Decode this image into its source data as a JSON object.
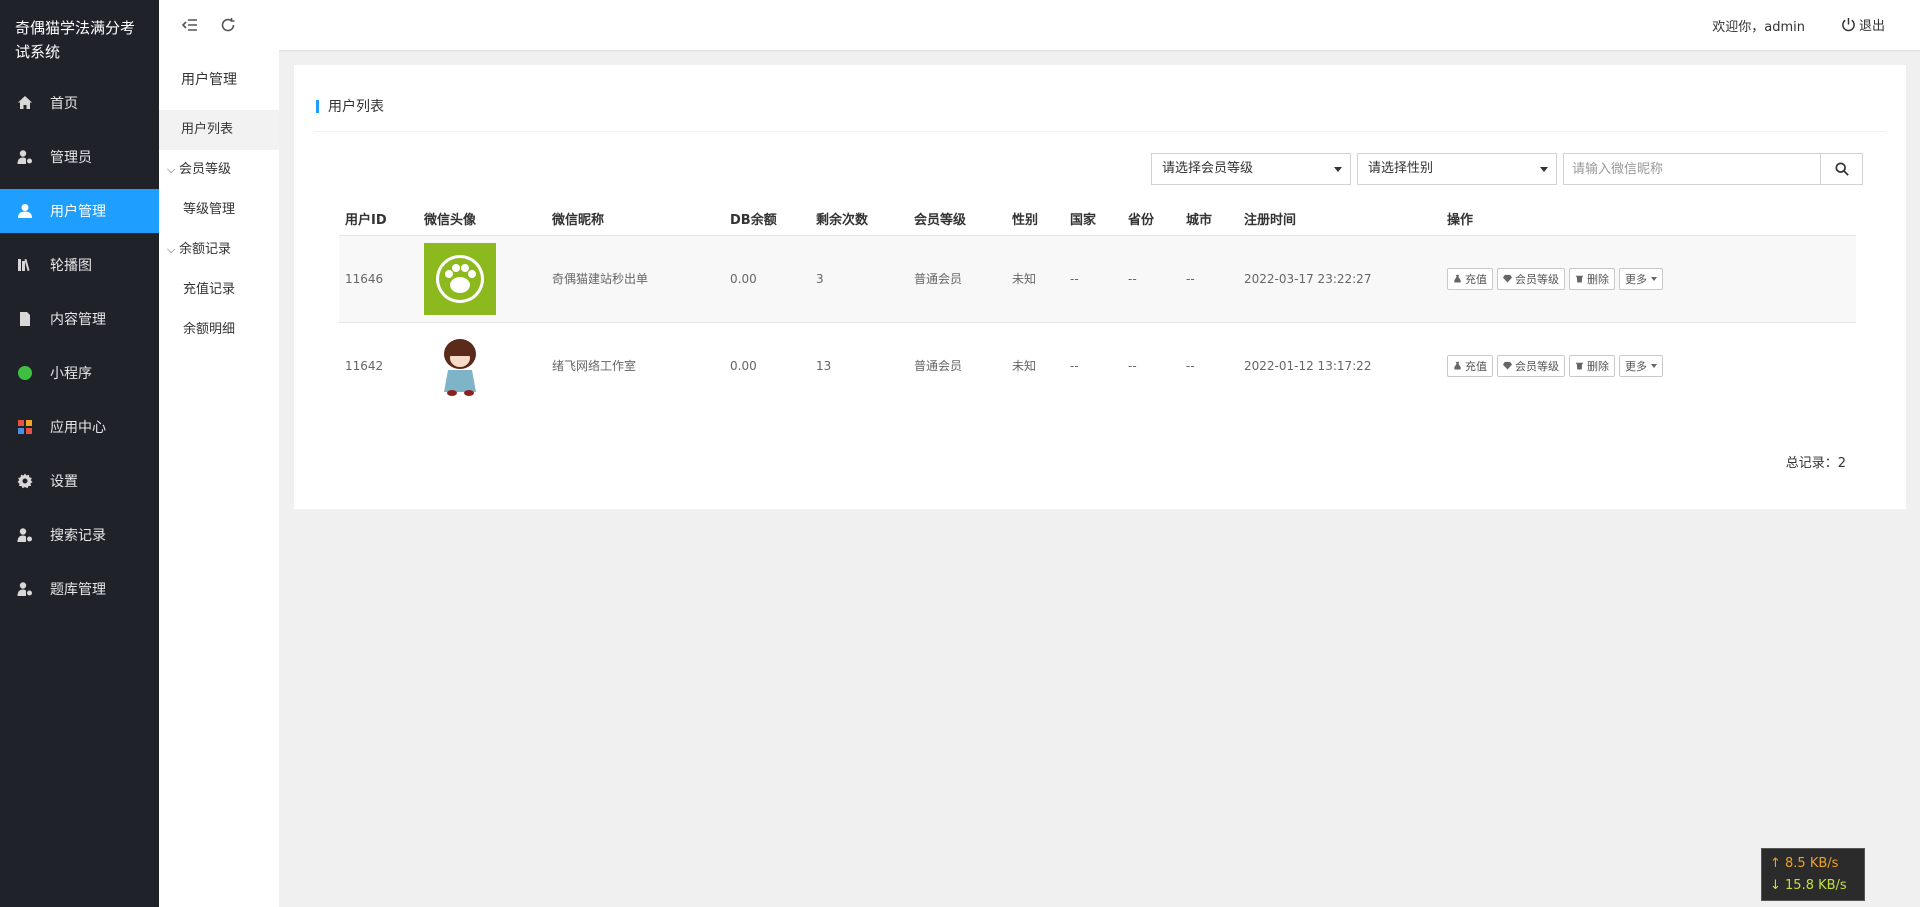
{
  "app": {
    "title": "奇偶猫学法满分考试系统"
  },
  "menu": {
    "items": [
      {
        "label": "首页",
        "icon": "home-icon"
      },
      {
        "label": "管理员",
        "icon": "user-gear-icon"
      },
      {
        "label": "用户管理",
        "icon": "user-icon",
        "active": true
      },
      {
        "label": "轮播图",
        "icon": "books-icon"
      },
      {
        "label": "内容管理",
        "icon": "document-icon"
      },
      {
        "label": "小程序",
        "icon": "miniprogram-icon"
      },
      {
        "label": "应用中心",
        "icon": "apps-icon"
      },
      {
        "label": "设置",
        "icon": "gear-icon"
      },
      {
        "label": "搜索记录",
        "icon": "user-gear-icon"
      },
      {
        "label": "题库管理",
        "icon": "user-gear-icon"
      }
    ]
  },
  "subnav": {
    "title": "用户管理",
    "items": {
      "user_list": "用户列表",
      "member_level": "会员等级",
      "level_manage": "等级管理",
      "balance_records": "余额记录",
      "recharge_records": "充值记录",
      "balance_detail": "余额明细"
    }
  },
  "header": {
    "welcome": "欢迎你，admin",
    "logout": "退出"
  },
  "card": {
    "title": "用户列表",
    "filters": {
      "level_select": "请选择会员等级",
      "gender_select": "请选择性别",
      "nickname_placeholder": "请输入微信昵称"
    },
    "columns": [
      "用户ID",
      "微信头像",
      "微信昵称",
      "DB余额",
      "剩余次数",
      "会员等级",
      "性别",
      "国家",
      "省份",
      "城市",
      "注册时间",
      "操作"
    ],
    "rows": [
      {
        "id": "11646",
        "nickname": "奇偶猫建站秒出单",
        "balance": "0.00",
        "remaining": "3",
        "level": "普通会员",
        "gender": "未知",
        "country": "--",
        "province": "--",
        "city": "--",
        "registered": "2022-03-17 23:22:27"
      },
      {
        "id": "11642",
        "nickname": "绪飞网络工作室",
        "balance": "0.00",
        "remaining": "13",
        "level": "普通会员",
        "gender": "未知",
        "country": "--",
        "province": "--",
        "city": "--",
        "registered": "2022-01-12 13:17:22"
      }
    ],
    "actions": {
      "recharge": "充值",
      "member_level": "会员等级",
      "delete": "删除",
      "more": "更多"
    },
    "total": "总记录：2"
  },
  "netspeed": {
    "up": "↑ 8.5 KB/s",
    "down": "↓ 15.8 KB/s"
  },
  "colors": {
    "accent": "#1e9fff",
    "sidebar_bg": "#20222a"
  }
}
